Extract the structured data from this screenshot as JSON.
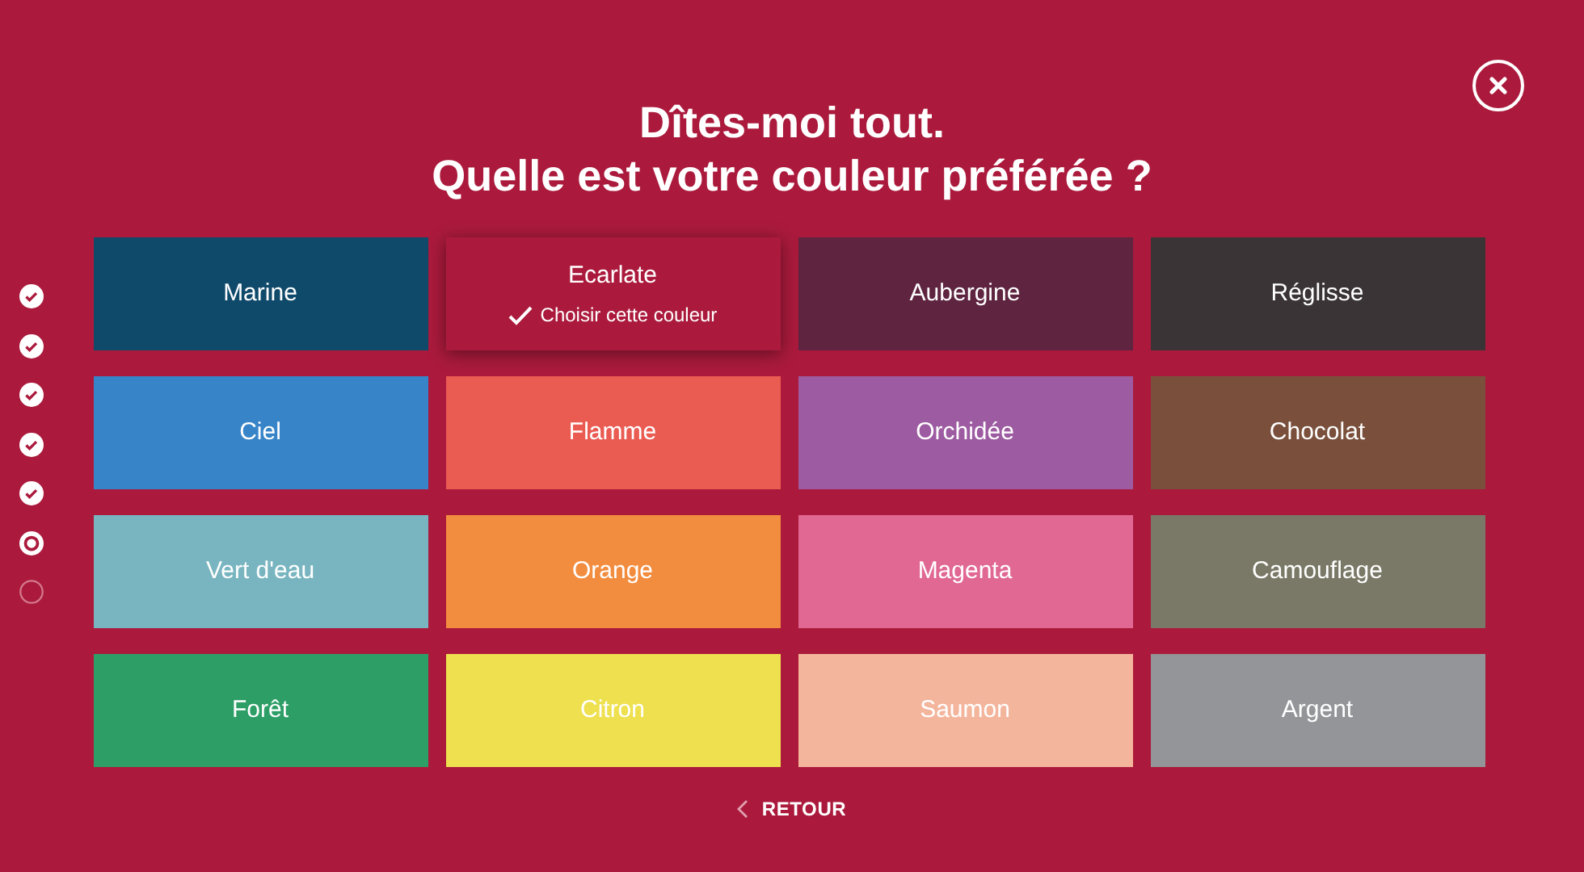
{
  "title_lines": [
    "Dîtes-moi tout.",
    "Quelle est votre couleur préférée ?"
  ],
  "steps": [
    {
      "kind": "done"
    },
    {
      "kind": "done"
    },
    {
      "kind": "done"
    },
    {
      "kind": "done"
    },
    {
      "kind": "done"
    },
    {
      "kind": "current"
    },
    {
      "kind": "pending"
    }
  ],
  "colors": [
    {
      "label": "Marine",
      "color": "#0f4a6b",
      "selected": false
    },
    {
      "label": "Ecarlate",
      "color": "#ab1a3c",
      "selected": true,
      "choose_label": "Choisir cette couleur"
    },
    {
      "label": "Aubergine",
      "color": "#5e2440",
      "selected": false
    },
    {
      "label": "Réglisse",
      "color": "#3a3436",
      "selected": false
    },
    {
      "label": "Ciel",
      "color": "#3784c8",
      "selected": false
    },
    {
      "label": "Flamme",
      "color": "#ea5b52",
      "selected": false
    },
    {
      "label": "Orchidée",
      "color": "#9d5ba1",
      "selected": false
    },
    {
      "label": "Chocolat",
      "color": "#7a503c",
      "selected": false
    },
    {
      "label": "Vert d'eau",
      "color": "#79b5c0",
      "selected": false
    },
    {
      "label": "Orange",
      "color": "#f28c3e",
      "selected": false
    },
    {
      "label": "Magenta",
      "color": "#e06893",
      "selected": false
    },
    {
      "label": "Camouflage",
      "color": "#7a7866",
      "selected": false
    },
    {
      "label": "Forêt",
      "color": "#2d9e66",
      "selected": false
    },
    {
      "label": "Citron",
      "color": "#eee04e",
      "selected": false
    },
    {
      "label": "Saumon",
      "color": "#f4b59d",
      "selected": false
    },
    {
      "label": "Argent",
      "color": "#939598",
      "selected": false
    }
  ],
  "back_label": "RETOUR"
}
